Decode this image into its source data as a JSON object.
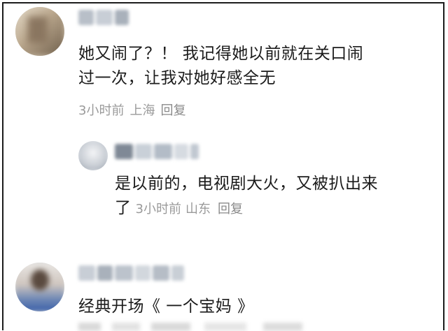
{
  "comments": [
    {
      "text": "她又闹了？！ 我记得她以前就在关口闹过一次，让我对她好感全无",
      "line1": "她又闹了？！ 我记得她以前就在关口闹",
      "line2": "过一次，让我对她好感全无",
      "time": "3小时前",
      "location": "上海",
      "reply_label": "回复"
    },
    {
      "text": "是以前的，电视剧大火，又被扒出来了",
      "line1": "是以前的，电视剧大火，又被扒出来",
      "line2": "了",
      "time": "3小时前",
      "location": "山东",
      "reply_label": "回复"
    },
    {
      "text": "经典开场《 一个宝妈 》",
      "line1": "经典开场《 一个宝妈 》"
    }
  ],
  "colors": {
    "text": "#1b1b1b",
    "meta": "#9a9a9a",
    "frame": "#1c1c1c"
  }
}
